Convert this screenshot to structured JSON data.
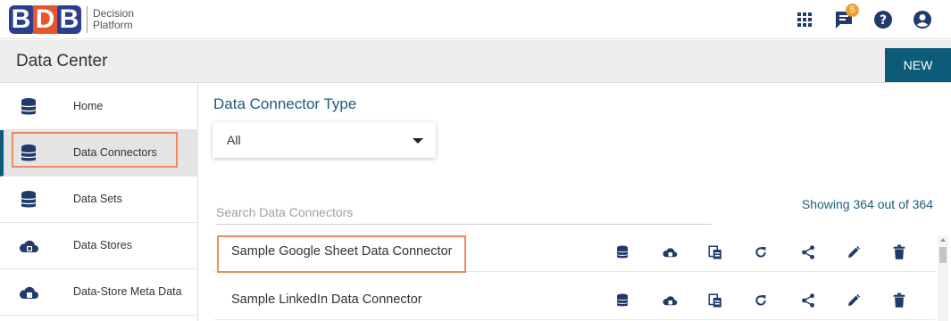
{
  "brand": {
    "logo_letters": [
      "B",
      "D",
      "B"
    ],
    "line1": "Decision",
    "line2": "Platform"
  },
  "header": {
    "notification_count": "5",
    "icons": [
      "apps-grid-icon",
      "notifications-icon",
      "help-icon",
      "account-icon"
    ]
  },
  "titlebar": {
    "title": "Data Center",
    "new_label": "NEW"
  },
  "sidebar": {
    "items": [
      {
        "label": "Home",
        "icon": "database-icon",
        "active": false
      },
      {
        "label": "Data Connectors",
        "icon": "database-icon",
        "active": true
      },
      {
        "label": "Data Sets",
        "icon": "database-icon",
        "active": false
      },
      {
        "label": "Data Stores",
        "icon": "cloud-store-icon",
        "active": false
      },
      {
        "label": "Data-Store Meta Data",
        "icon": "cloud-store-icon",
        "active": false
      }
    ]
  },
  "main": {
    "section_title": "Data Connector Type",
    "type_filter": {
      "selected": "All"
    },
    "search": {
      "placeholder": "Search Data Connectors",
      "value": ""
    },
    "showing_text": "Showing 364 out of 364",
    "rows": [
      {
        "name": "Sample Google Sheet Data Connector"
      },
      {
        "name": "Sample LinkedIn Data Connector"
      }
    ],
    "row_actions": [
      "create-dataset-icon",
      "create-datastore-icon",
      "copy-icon",
      "refresh-icon",
      "share-icon",
      "edit-icon",
      "delete-icon"
    ]
  },
  "colors": {
    "accent": "#0c5b78",
    "title_text": "#1d5c7c",
    "highlight": "#ef8a60",
    "badge": "#f0a028"
  }
}
